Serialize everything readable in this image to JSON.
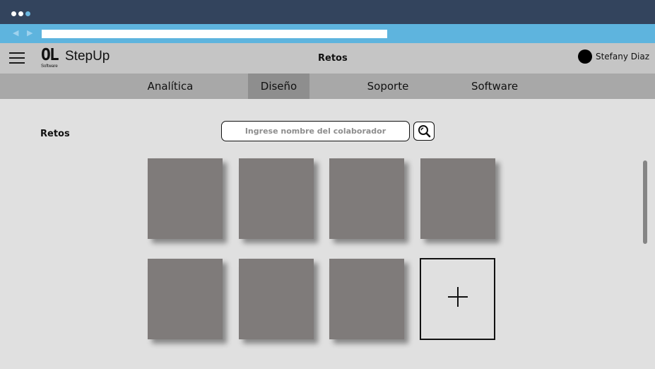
{
  "browser": {
    "dots": [
      "dot",
      "dot",
      "dot-blue"
    ],
    "nav": {
      "back_icon": "chevron-left-icon",
      "forward_icon": "chevron-right-icon"
    },
    "address_value": ""
  },
  "header": {
    "menu_icon": "hamburger-icon",
    "logo": {
      "mark": "OL",
      "sub": "Software"
    },
    "app_name": "StepUp",
    "title": "Retos",
    "user": {
      "name": "Stefany Diaz"
    }
  },
  "tabs": [
    {
      "label": "Analítica",
      "active": false
    },
    {
      "label": "Diseño",
      "active": true
    },
    {
      "label": "Soporte",
      "active": false
    },
    {
      "label": "Software",
      "active": false
    }
  ],
  "content": {
    "section_label": "Retos",
    "search": {
      "placeholder": "Ingrese nombre del colaborador",
      "value": "",
      "icon": "search-icon"
    },
    "card_count": 7,
    "add_card_icon": "plus-icon"
  },
  "colors": {
    "titlebar": "#33445d",
    "addressbar": "#5eb4de",
    "header": "#c5c5c5",
    "tabs": "#a8a8a8",
    "tab_active": "#8e8e8e",
    "card": "#7f7b7a",
    "background": "#e0e0e0"
  }
}
